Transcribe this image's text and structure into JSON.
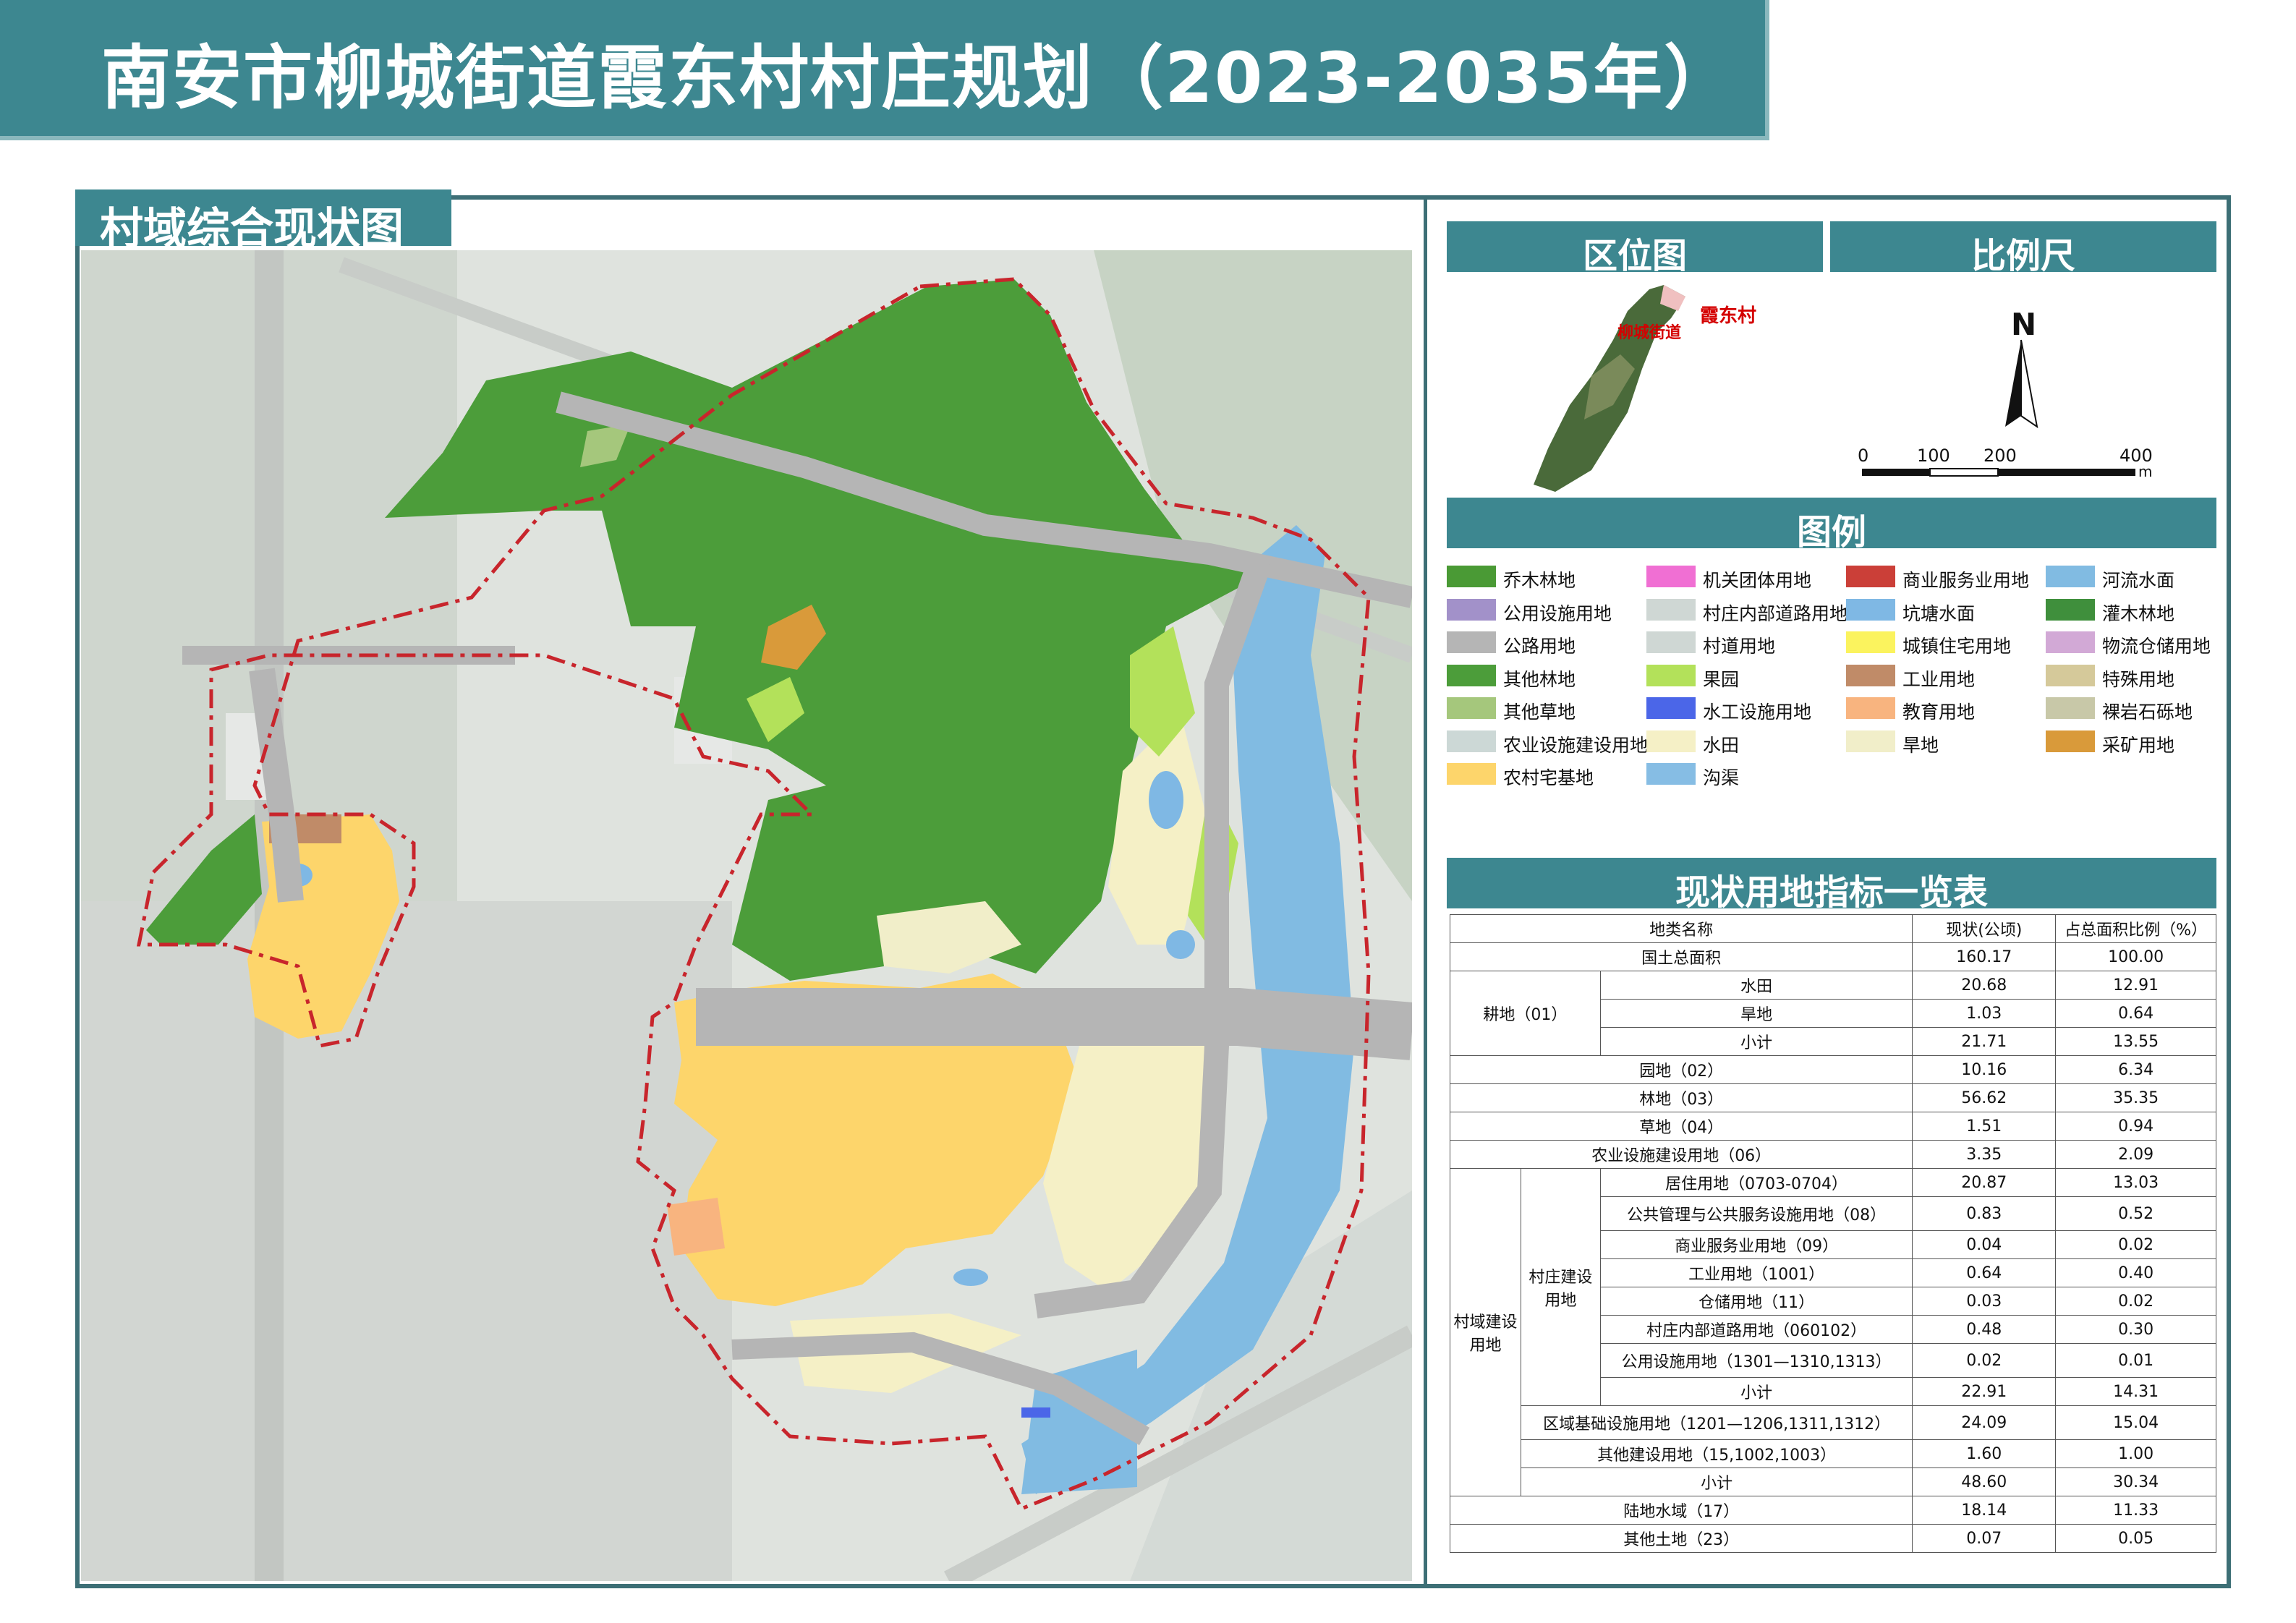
{
  "title": "南安市柳城街道霞东村村庄规划（2023-2035年）",
  "map_title": "村域综合现状图",
  "panels": {
    "location": "区位图",
    "scale": "比例尺",
    "legend": "图例",
    "table": "现状用地指标一览表"
  },
  "location_map": {
    "label_village": "霞东村",
    "label_street": "柳城街道"
  },
  "scale_bar": {
    "north": "N",
    "ticks": [
      "0",
      "100",
      "200",
      "400"
    ],
    "unit": "m"
  },
  "legend_items": [
    {
      "label": "乔木林地",
      "color": "#4a9a35"
    },
    {
      "label": "公用设施用地",
      "color": "#a291c9"
    },
    {
      "label": "公路用地",
      "color": "#b5b5b5"
    },
    {
      "label": "其他林地",
      "color": "#4c9d3a"
    },
    {
      "label": "其他草地",
      "color": "#a5c77c"
    },
    {
      "label": "农业设施建设用地",
      "color": "#ccd8d6"
    },
    {
      "label": "农村宅基地",
      "color": "#fdd56b"
    },
    {
      "label": "机关团体用地",
      "color": "#f06fd3"
    },
    {
      "label": "村庄内部道路用地",
      "color": "#cfd7d4"
    },
    {
      "label": "村道用地",
      "color": "#cfd7d4"
    },
    {
      "label": "果园",
      "color": "#b3e15a"
    },
    {
      "label": "水工设施用地",
      "color": "#4b66e8"
    },
    {
      "label": "水田",
      "color": "#f5f0c6"
    },
    {
      "label": "沟渠",
      "color": "#86bde4"
    },
    {
      "label": "商业服务业用地",
      "color": "#cb3f38"
    },
    {
      "label": "坑塘水面",
      "color": "#7fb8e4"
    },
    {
      "label": "城镇住宅用地",
      "color": "#fbf35e"
    },
    {
      "label": "工业用地",
      "color": "#c08b68"
    },
    {
      "label": "教育用地",
      "color": "#f8b47f"
    },
    {
      "label": "旱地",
      "color": "#f1eec9"
    },
    {
      "label": "河流水面",
      "color": "#81bbe2"
    },
    {
      "label": "灌木林地",
      "color": "#3f8f3c"
    },
    {
      "label": "物流仓储用地",
      "color": "#d2a9d6"
    },
    {
      "label": "特殊用地",
      "color": "#d5c99a"
    },
    {
      "label": "裸岩石砾地",
      "color": "#c8c8a8"
    },
    {
      "label": "采矿用地",
      "color": "#d99a3a"
    }
  ],
  "table": {
    "header": [
      "地类名称",
      "现状(公顷)",
      "占总面积比例（%）"
    ],
    "total": {
      "label": "国土总面积",
      "value": "160.17",
      "pct": "100.00"
    },
    "gengdi_label": "耕地（01）",
    "gengdi_rows": [
      {
        "label": "水田",
        "value": "20.68",
        "pct": "12.91"
      },
      {
        "label": "旱地",
        "value": "1.03",
        "pct": "0.64"
      },
      {
        "label": "小计",
        "value": "21.71",
        "pct": "13.55"
      }
    ],
    "simple_rows": [
      {
        "label": "园地（02）",
        "value": "10.16",
        "pct": "6.34"
      },
      {
        "label": "林地（03）",
        "value": "56.62",
        "pct": "35.35"
      },
      {
        "label": "草地（04）",
        "value": "1.51",
        "pct": "0.94"
      },
      {
        "label": "农业设施建设用地（06）",
        "value": "3.35",
        "pct": "2.09"
      }
    ],
    "cunyu_label": "村域建设用地",
    "cunzhuang_label": "村庄建设用地",
    "cunzhuang_rows": [
      {
        "label": "居住用地（0703-0704）",
        "value": "20.87",
        "pct": "13.03"
      },
      {
        "label": "公共管理与公共服务设施用地（08）",
        "value": "0.83",
        "pct": "0.52"
      },
      {
        "label": "商业服务业用地（09）",
        "value": "0.04",
        "pct": "0.02"
      },
      {
        "label": "工业用地（1001）",
        "value": "0.64",
        "pct": "0.40"
      },
      {
        "label": "仓储用地（11）",
        "value": "0.03",
        "pct": "0.02"
      },
      {
        "label": "村庄内部道路用地（060102）",
        "value": "0.48",
        "pct": "0.30"
      },
      {
        "label": "公用设施用地（1301—1310,1313）",
        "value": "0.02",
        "pct": "0.01"
      },
      {
        "label": "小计",
        "value": "22.91",
        "pct": "14.31"
      }
    ],
    "cunyu_rows": [
      {
        "label": "区域基础设施用地（1201—1206,1311,1312）",
        "value": "24.09",
        "pct": "15.04"
      },
      {
        "label": "其他建设用地（15,1002,1003）",
        "value": "1.60",
        "pct": "1.00"
      },
      {
        "label": "小计",
        "value": "48.60",
        "pct": "30.34"
      }
    ],
    "tail_rows": [
      {
        "label": "陆地水域（17）",
        "value": "18.14",
        "pct": "11.33"
      },
      {
        "label": "其他土地（23）",
        "value": "0.07",
        "pct": "0.05"
      }
    ]
  }
}
